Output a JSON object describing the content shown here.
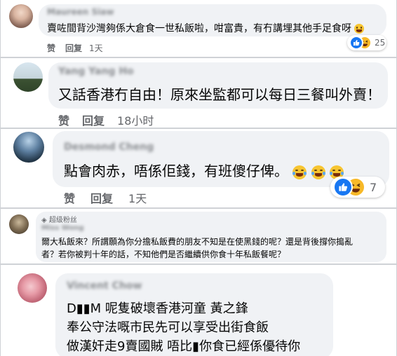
{
  "colors": {
    "bubble": "#f0f2f5",
    "meta": "#65676b",
    "like": "#1877f2",
    "haha": "#f7b928"
  },
  "comments": [
    {
      "author": "Maureen Siaw",
      "text": "賣咗間背沙灣夠係大倉食一世私飯啦，咁富貴，有冇講埋其他手足食呀",
      "actions": {
        "like": "赞",
        "reply": "回复",
        "time": "1天"
      },
      "reactions": {
        "icons": [
          "like-icon",
          "haha-icon"
        ],
        "count": "25"
      }
    },
    {
      "author": "Yang Yang Ho",
      "text": "又話香港冇自由！原來坐監都可以每日三餐叫外賣！",
      "actions": {
        "like": "赞",
        "reply": "回复",
        "time": "18小时"
      }
    },
    {
      "author": "Desmond Cheng",
      "text": "點會肉赤，唔係佢錢，有班傻仔俾。",
      "actions": {
        "like": "赞",
        "reply": "回复",
        "time": "1天"
      },
      "reactions": {
        "icons": [
          "like-icon",
          "haha-icon"
        ],
        "count": "7"
      }
    },
    {
      "badge": "超级粉丝",
      "author": "Miss Wong",
      "text_lines": [
        "爾大私飯來？所謂願為你分擔私飯費的朋友不知是在使黑錢的呢？還是背後撐你搗亂",
        "者？若你被判十年的話，不知他們是否繼續供你食十年私飯餐呢？"
      ]
    },
    {
      "author": "Vincent Chow",
      "text_lines": [
        "D▮▮M 呢隻破壞香港河童 黃之鋒",
        "奉公守法嘅市民先可以享受出街食飯",
        "做漢奸走9賣國賊 唔比▮你食已經係優待你"
      ]
    }
  ]
}
